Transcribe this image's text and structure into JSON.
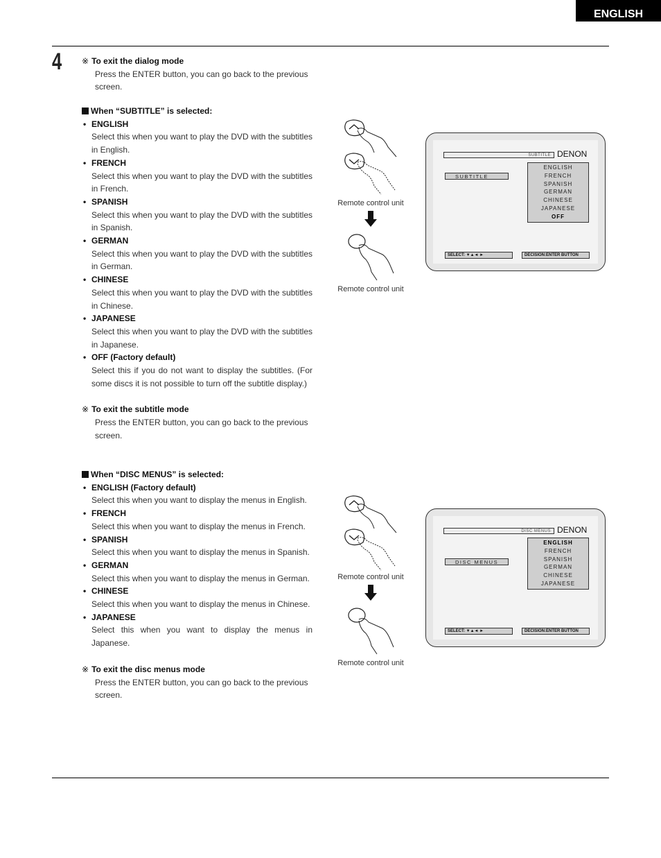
{
  "header": {
    "language_tab": "ENGLISH"
  },
  "step_number": "4",
  "dialog_exit_note": {
    "mark": "※",
    "title": "To exit the dialog mode",
    "body": "Press the ENTER button, you can go back to the previous screen."
  },
  "subtitle_section": {
    "heading": "When “SUBTITLE” is selected:",
    "items": [
      {
        "title": "ENGLISH",
        "body": "Select this when you want to play the DVD with the subtitles in English."
      },
      {
        "title": "FRENCH",
        "body": "Select this when you want to play the DVD with the subtitles in French."
      },
      {
        "title": "SPANISH",
        "body": "Select this when you want to play the DVD with the subtitles in Spanish."
      },
      {
        "title": "GERMAN",
        "body": "Select this when you want to play the DVD with the subtitles in German."
      },
      {
        "title": "CHINESE",
        "body": "Select this when you want to play the DVD with the subtitles in Chinese."
      },
      {
        "title": "JAPANESE",
        "body": "Select this when you want to play the DVD with the subtitles in Japanese."
      },
      {
        "title": "OFF (Factory default)",
        "body": "Select this if you do not want to display the subtitles. (For some discs it is not possible to turn off the subtitle display.)"
      }
    ],
    "exit_note": {
      "mark": "※",
      "title": "To exit the subtitle mode",
      "body": "Press the ENTER button, you can go back to the previous screen."
    },
    "remote_labels": [
      "Remote control unit",
      "Remote control unit"
    ],
    "screen": {
      "title_bar": "SUBTITLE",
      "brand": "DENON",
      "setting_label": "SUBTITLE",
      "options": [
        "ENGLISH",
        "FRENCH",
        "SPANISH",
        "GERMAN",
        "CHINESE",
        "JAPANESE",
        "OFF"
      ],
      "selected_option": "OFF",
      "select_hint": "SELECT:  ▼▲◄ ►",
      "decision_hint": "DECISION:ENTER BUTTON"
    }
  },
  "disc_menus_section": {
    "heading": "When “DISC MENUS” is selected:",
    "items": [
      {
        "title": "ENGLISH (Factory default)",
        "body": "Select this when you want to display the menus in English."
      },
      {
        "title": "FRENCH",
        "body": "Select this when you want to display the menus in French."
      },
      {
        "title": "SPANISH",
        "body": "Select this when you want to display the menus in Spanish."
      },
      {
        "title": "GERMAN",
        "body": "Select this when you want to display the menus in German."
      },
      {
        "title": "CHINESE",
        "body": "Select this when you want to display the menus in Chinese."
      },
      {
        "title": "JAPANESE",
        "body": "Select this when you want to display the menus in Japanese."
      }
    ],
    "exit_note": {
      "mark": "※",
      "title": "To exit the disc menus mode",
      "body": "Press the ENTER button, you can go back to the previous screen."
    },
    "remote_labels": [
      "Remote control unit",
      "Remote control unit"
    ],
    "screen": {
      "title_bar": "DISC MENUS",
      "brand": "DENON",
      "setting_label": "DISC MENUS",
      "options": [
        "ENGLISH",
        "FRENCH",
        "SPANISH",
        "GERMAN",
        "CHINESE",
        "JAPANESE"
      ],
      "selected_option": "ENGLISH",
      "select_hint": "SELECT:  ▼▲◄ ►",
      "decision_hint": "DECISION:ENTER BUTTON"
    }
  }
}
